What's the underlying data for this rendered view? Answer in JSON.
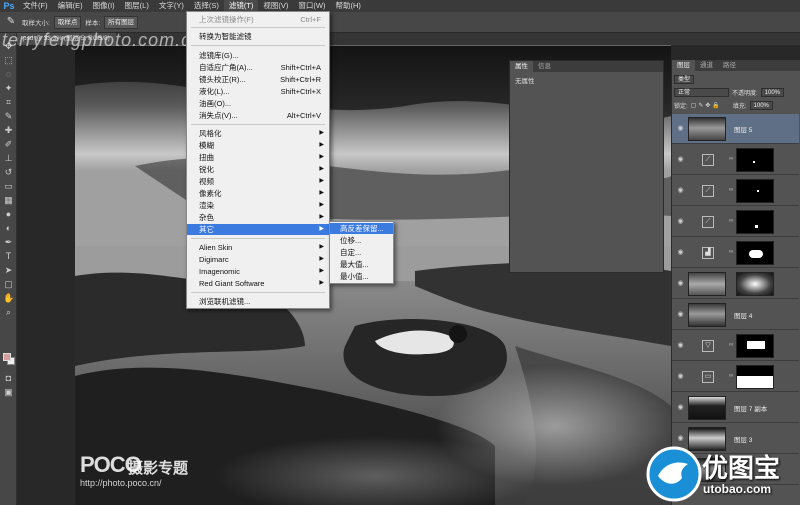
{
  "app": {
    "logo": "Ps"
  },
  "menubar": {
    "items": [
      {
        "label": "文件(F)"
      },
      {
        "label": "编辑(E)"
      },
      {
        "label": "图像(I)"
      },
      {
        "label": "图层(L)"
      },
      {
        "label": "文字(Y)"
      },
      {
        "label": "选择(S)"
      },
      {
        "label": "滤镜(T)",
        "active": true
      },
      {
        "label": "视图(V)"
      },
      {
        "label": "窗口(W)"
      },
      {
        "label": "帮助(H)"
      }
    ]
  },
  "options_bar": {
    "sample_size_label": "取样大小:",
    "sample_size_value": "取样点",
    "sample_label": "样本:",
    "sample_value": "所有图层"
  },
  "document_tab": {
    "label": "psd @ 33.3% (图层 5, RGB/8)"
  },
  "watermarks": {
    "top_left": "terryfengphoto.com.cn",
    "poco_logo": "POCO",
    "poco_sub": "摄影专题",
    "poco_url": "http://photo.poco.cn/",
    "utobao_cn": "优图宝",
    "utobao_en": "utobao.com"
  },
  "filter_menu": {
    "rows": [
      {
        "label": "上次滤镜操作(F)",
        "shortcut": "Ctrl+F",
        "disabled": true
      },
      {
        "label": "转换为智能滤镜"
      },
      {
        "label": "滤镜库(G)..."
      },
      {
        "label": "自适应广角(A)...",
        "shortcut": "Shift+Ctrl+A"
      },
      {
        "label": "镜头校正(R)...",
        "shortcut": "Shift+Ctrl+R"
      },
      {
        "label": "液化(L)...",
        "shortcut": "Shift+Ctrl+X"
      },
      {
        "label": "油画(O)..."
      },
      {
        "label": "消失点(V)...",
        "shortcut": "Alt+Ctrl+V"
      },
      {
        "label": "风格化",
        "submenu": true
      },
      {
        "label": "模糊",
        "submenu": true
      },
      {
        "label": "扭曲",
        "submenu": true
      },
      {
        "label": "锐化",
        "submenu": true
      },
      {
        "label": "视频",
        "submenu": true
      },
      {
        "label": "像素化",
        "submenu": true
      },
      {
        "label": "渲染",
        "submenu": true
      },
      {
        "label": "杂色",
        "submenu": true
      },
      {
        "label": "其它",
        "submenu": true,
        "highlighted": true
      },
      {
        "label": "Alien Skin",
        "submenu": true
      },
      {
        "label": "Digimarc",
        "submenu": true
      },
      {
        "label": "Imagenomic",
        "submenu": true
      },
      {
        "label": "Red Giant Software",
        "submenu": true
      },
      {
        "label": "浏览联机滤镜..."
      }
    ]
  },
  "other_submenu": {
    "rows": [
      {
        "label": "高反差保留...",
        "highlighted": true
      },
      {
        "label": "位移..."
      },
      {
        "label": "自定..."
      },
      {
        "label": "最大值..."
      },
      {
        "label": "最小值..."
      }
    ]
  },
  "properties_panel": {
    "tabs": [
      {
        "label": "属性",
        "active": true
      },
      {
        "label": "信息"
      }
    ],
    "content": "无属性"
  },
  "layers_panel": {
    "tabs": [
      {
        "label": "图层",
        "active": true
      },
      {
        "label": "通道"
      },
      {
        "label": "路径"
      }
    ],
    "filter_kind": "类型",
    "blend_mode": "正常",
    "opacity_label": "不透明度:",
    "opacity_value": "100%",
    "lock_label": "锁定:",
    "fill_label": "填充:",
    "fill_value": "100%",
    "layers": [
      {
        "name": "图层 5",
        "type": "photo",
        "selected": true
      },
      {
        "name": "",
        "type": "curves"
      },
      {
        "name": "",
        "type": "curves"
      },
      {
        "name": "",
        "type": "curves"
      },
      {
        "name": "",
        "type": "levels"
      },
      {
        "name": "",
        "type": "photo-mask"
      },
      {
        "name": "图层 4",
        "type": "photo"
      },
      {
        "name": "",
        "type": "gradient"
      },
      {
        "name": "",
        "type": "hue"
      },
      {
        "name": "图层 7 副本",
        "type": "photo"
      },
      {
        "name": "图层 3",
        "type": "photo"
      },
      {
        "name": "图层 1",
        "type": "photo"
      }
    ]
  }
}
